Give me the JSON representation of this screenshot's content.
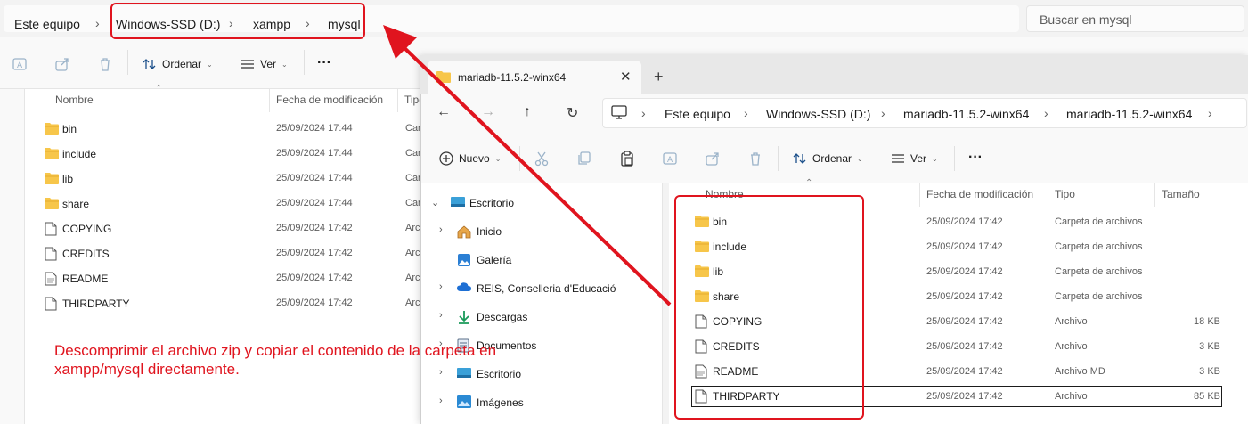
{
  "back_window": {
    "breadcrumbs": [
      "Este equipo",
      "Windows-SSD (D:)",
      "xampp",
      "mysql"
    ],
    "search_placeholder": "Buscar en mysql",
    "toolbar": {
      "sort_label": "Ordenar",
      "view_label": "Ver",
      "more_label": "···"
    },
    "columns": {
      "name": "Nombre",
      "date": "Fecha de modificación",
      "type": "Tipo"
    },
    "rows": [
      {
        "name": "bin",
        "date": "25/09/2024 17:44",
        "type": "Car",
        "icon": "folder-icon"
      },
      {
        "name": "include",
        "date": "25/09/2024 17:44",
        "type": "Car",
        "icon": "folder-icon"
      },
      {
        "name": "lib",
        "date": "25/09/2024 17:44",
        "type": "Car",
        "icon": "folder-icon"
      },
      {
        "name": "share",
        "date": "25/09/2024 17:44",
        "type": "Car",
        "icon": "folder-icon"
      },
      {
        "name": "COPYING",
        "date": "25/09/2024 17:42",
        "type": "Archi",
        "icon": "file-icon"
      },
      {
        "name": "CREDITS",
        "date": "25/09/2024 17:42",
        "type": "Archi",
        "icon": "file-icon"
      },
      {
        "name": "README",
        "date": "25/09/2024 17:42",
        "type": "Archi",
        "icon": "text-file-icon"
      },
      {
        "name": "THIRDPARTY",
        "date": "25/09/2024 17:42",
        "type": "Archi",
        "icon": "file-icon"
      }
    ]
  },
  "front_window": {
    "tab_title": "mariadb-11.5.2-winx64",
    "tab_close": "✕",
    "new_tab": "+",
    "breadcrumbs": [
      "Este equipo",
      "Windows-SSD (D:)",
      "mariadb-11.5.2-winx64",
      "mariadb-11.5.2-winx64"
    ],
    "toolbar": {
      "new_label": "Nuevo",
      "sort_label": "Ordenar",
      "view_label": "Ver",
      "more_label": "···"
    },
    "sidebar": [
      {
        "label": "Escritorio",
        "icon": "desktop-icon",
        "expanded": true
      },
      {
        "label": "Inicio",
        "icon": "home-icon"
      },
      {
        "label": "Galería",
        "icon": "gallery-icon"
      },
      {
        "label": "REIS, Conselleria d'Educació",
        "icon": "cloud-icon"
      },
      {
        "label": "Descargas",
        "icon": "download-icon"
      },
      {
        "label": "Documentos",
        "icon": "documents-icon"
      },
      {
        "label": "Escritorio",
        "icon": "desktop-icon"
      },
      {
        "label": "Imágenes",
        "icon": "pictures-icon"
      }
    ],
    "columns": {
      "name": "Nombre",
      "date": "Fecha de modificación",
      "type": "Tipo",
      "size": "Tamaño"
    },
    "rows": [
      {
        "name": "bin",
        "date": "25/09/2024 17:42",
        "type": "Carpeta de archivos",
        "size": "",
        "icon": "folder-icon"
      },
      {
        "name": "include",
        "date": "25/09/2024 17:42",
        "type": "Carpeta de archivos",
        "size": "",
        "icon": "folder-icon"
      },
      {
        "name": "lib",
        "date": "25/09/2024 17:42",
        "type": "Carpeta de archivos",
        "size": "",
        "icon": "folder-icon"
      },
      {
        "name": "share",
        "date": "25/09/2024 17:42",
        "type": "Carpeta de archivos",
        "size": "",
        "icon": "folder-icon"
      },
      {
        "name": "COPYING",
        "date": "25/09/2024 17:42",
        "type": "Archivo",
        "size": "18 KB",
        "icon": "file-icon"
      },
      {
        "name": "CREDITS",
        "date": "25/09/2024 17:42",
        "type": "Archivo",
        "size": "3 KB",
        "icon": "file-icon"
      },
      {
        "name": "README",
        "date": "25/09/2024 17:42",
        "type": "Archivo MD",
        "size": "3 KB",
        "icon": "text-file-icon"
      },
      {
        "name": "THIRDPARTY",
        "date": "25/09/2024 17:42",
        "type": "Archivo",
        "size": "85 KB",
        "icon": "file-icon"
      }
    ]
  },
  "annotation": {
    "text": "Descomprimir el archivo zip y copiar el contenido de la carpeta en xampp/mysql directamente.",
    "color": "#e0141e"
  },
  "colors": {
    "folder": "#f7c64a",
    "highlight": "#e0141e"
  }
}
